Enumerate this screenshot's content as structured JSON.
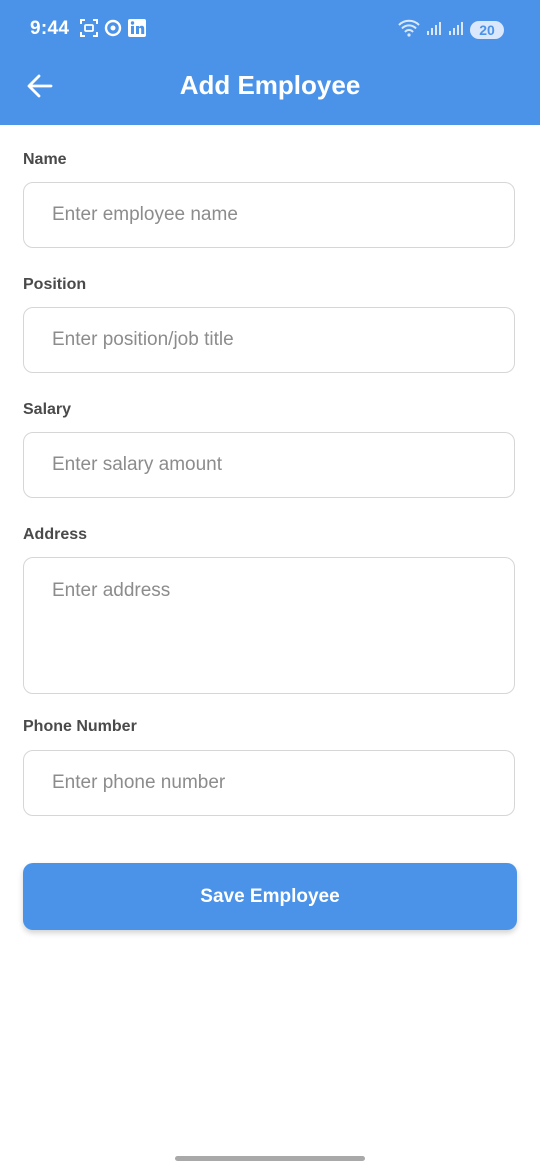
{
  "status_bar": {
    "time": "9:44",
    "battery": "20",
    "icons_left": [
      "screenshot-icon",
      "sync-icon",
      "linkedin-icon"
    ],
    "icons_right": [
      "wifi-icon",
      "signal-icon",
      "signal-icon"
    ]
  },
  "app_bar": {
    "title": "Add Employee",
    "back_icon": "arrow-left-icon",
    "background": "#4a93e9"
  },
  "form": {
    "name": {
      "label": "Name",
      "placeholder": "Enter employee name",
      "value": ""
    },
    "position": {
      "label": "Position",
      "placeholder": "Enter position/job title",
      "value": ""
    },
    "salary": {
      "label": "Salary",
      "placeholder": "Enter salary amount",
      "value": ""
    },
    "address": {
      "label": "Address",
      "placeholder": "Enter address",
      "value": ""
    },
    "phone": {
      "label": "Phone Number",
      "placeholder": "Enter phone number",
      "value": ""
    }
  },
  "actions": {
    "save_label": "Save Employee"
  }
}
